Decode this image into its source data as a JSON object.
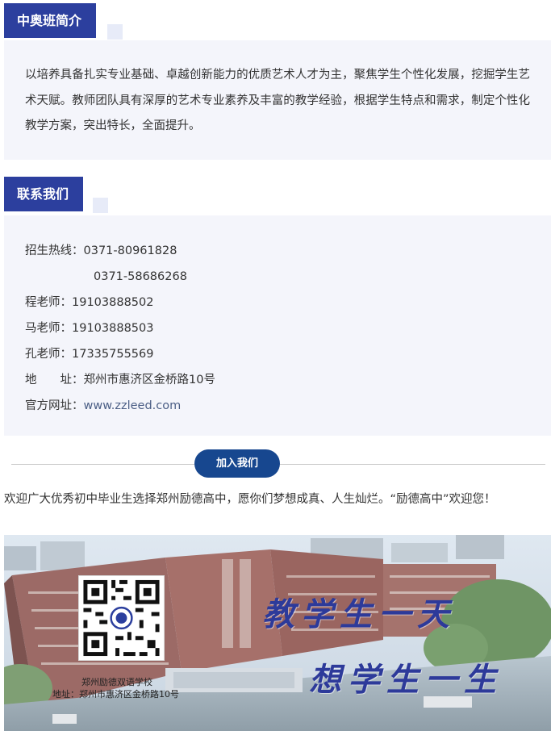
{
  "intro": {
    "title": "中奥班简介",
    "body": "以培养具备扎实专业基础、卓越创新能力的优质艺术人才为主，聚焦学生个性化发展，挖掘学生艺术天赋。教师团队具有深厚的艺术专业素养及丰富的教学经验，根据学生特点和需求，制定个性化教学方案，突出特长，全面提升。"
  },
  "contact": {
    "title": "联系我们",
    "hotline_label": "招生热线：",
    "hotline_1": "0371-80961828",
    "hotline_2": "0371-58686268",
    "teacher_cheng_label": "程老师：",
    "teacher_cheng_phone": "19103888502",
    "teacher_ma_label": "马老师：",
    "teacher_ma_phone": "19103888503",
    "teacher_kong_label": "孔老师：",
    "teacher_kong_phone": "17335755569",
    "address_label": "地　　址：",
    "address_value": "郑州市惠济区金桥路10号",
    "website_label": "官方网址：",
    "website_value": "www.zzleed.com"
  },
  "join": {
    "button_label": "加入我们",
    "welcome_text": "欢迎广大优秀初中毕业生选择郑州励德高中，愿你们梦想成真、人生灿烂。“励德高中”欢迎您！"
  },
  "banner": {
    "slogan_1": "教学生一天",
    "slogan_2": "想学生一生",
    "school_name": "郑州励德双语学校",
    "school_address": "地址：郑州市惠济区金桥路10号",
    "qr_icon": "qr-code-icon"
  },
  "colors": {
    "accent": "#2c3f9e",
    "pill": "#17478f",
    "panel_bg": "#f4f5fb"
  }
}
